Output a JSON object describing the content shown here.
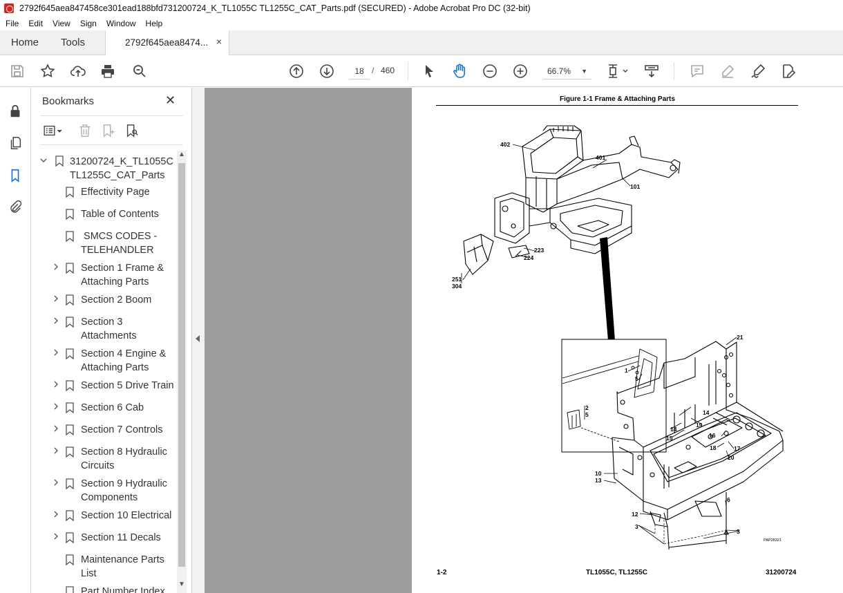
{
  "window": {
    "title": "2792f645aea847458ce301ead188bfd731200724_K_TL1055C TL1255C_CAT_Parts.pdf (SECURED) - Adobe Acrobat Pro DC (32-bit)"
  },
  "menu": [
    "File",
    "Edit",
    "View",
    "Sign",
    "Window",
    "Help"
  ],
  "tabs": {
    "home": "Home",
    "tools": "Tools",
    "document": "2792f645aea8474...",
    "close_glyph": "×"
  },
  "toolbar": {
    "current_page": "18",
    "page_separator": "/",
    "total_pages": "460",
    "zoom": "66.7%",
    "icons": [
      "save-icon",
      "star-icon",
      "upload-icon",
      "print-icon",
      "search-zoom-icon",
      "page-up-icon",
      "page-down-icon",
      "select-cursor-icon",
      "hand-icon",
      "zoom-out-icon",
      "zoom-in-icon",
      "page-fit-icon",
      "scroll-mode-icon",
      "comment-icon",
      "highlight-pen-icon",
      "sign-icon",
      "edit-pdf-icon"
    ]
  },
  "nav_rail": [
    "lock-icon",
    "pages-icon",
    "bookmark-icon",
    "attachment-icon"
  ],
  "bookmarks": {
    "title": "Bookmarks",
    "close_glyph": "✕",
    "root": {
      "line1": "31200724_K_TL1055C",
      "line2": "TL1255C_CAT_Parts"
    },
    "items": [
      {
        "line1": "Effectivity Page",
        "line2": "",
        "expandable": false
      },
      {
        "line1": "Table of Contents",
        "line2": "",
        "expandable": false
      },
      {
        "line1": " SMCS CODES -",
        "line2": "TELEHANDLER",
        "expandable": false
      },
      {
        "line1": "Section 1 Frame &",
        "line2": "Attaching Parts",
        "expandable": true
      },
      {
        "line1": "Section 2 Boom",
        "line2": "",
        "expandable": true
      },
      {
        "line1": "Section 3",
        "line2": "Attachments",
        "expandable": true
      },
      {
        "line1": "Section 4 Engine &",
        "line2": "Attaching Parts",
        "expandable": true
      },
      {
        "line1": "Section 5 Drive Train",
        "line2": "",
        "expandable": true
      },
      {
        "line1": "Section 6 Cab",
        "line2": "",
        "expandable": true
      },
      {
        "line1": "Section 7 Controls",
        "line2": "",
        "expandable": true
      },
      {
        "line1": "Section 8 Hydraulic",
        "line2": "Circuits",
        "expandable": true
      },
      {
        "line1": "Section 9 Hydraulic",
        "line2": "Components",
        "expandable": true
      },
      {
        "line1": "Section 10 Electrical",
        "line2": "",
        "expandable": true
      },
      {
        "line1": "Section 11 Decals",
        "line2": "",
        "expandable": true
      },
      {
        "line1": "Maintenance Parts",
        "line2": "List",
        "expandable": false
      },
      {
        "line1": "Part Number Index",
        "line2": "",
        "expandable": false
      }
    ]
  },
  "page": {
    "figure_title": "Figure 1-1 Frame & Attaching Parts",
    "footer_left": "1-2",
    "footer_mid": "TL1055C, TL1255C",
    "footer_right": "31200724",
    "drawing_code": "PAP28321",
    "callouts": {
      "c402": "402",
      "c401": "401",
      "c101": "101",
      "c223": "223",
      "c224": "224",
      "c251": "251",
      "c304": "304",
      "c21": "21",
      "c1": "1",
      "c5a": "5",
      "c2": "2",
      "c5b": "5",
      "c14a": "14",
      "c19": "19",
      "c14b": "14",
      "c15": "15",
      "c16": "16",
      "c17": "17",
      "c18": "18",
      "c20": "20",
      "c10": "10",
      "c13": "13",
      "c6": "6",
      "c12": "12",
      "c3a": "3",
      "c3b": "3"
    }
  }
}
